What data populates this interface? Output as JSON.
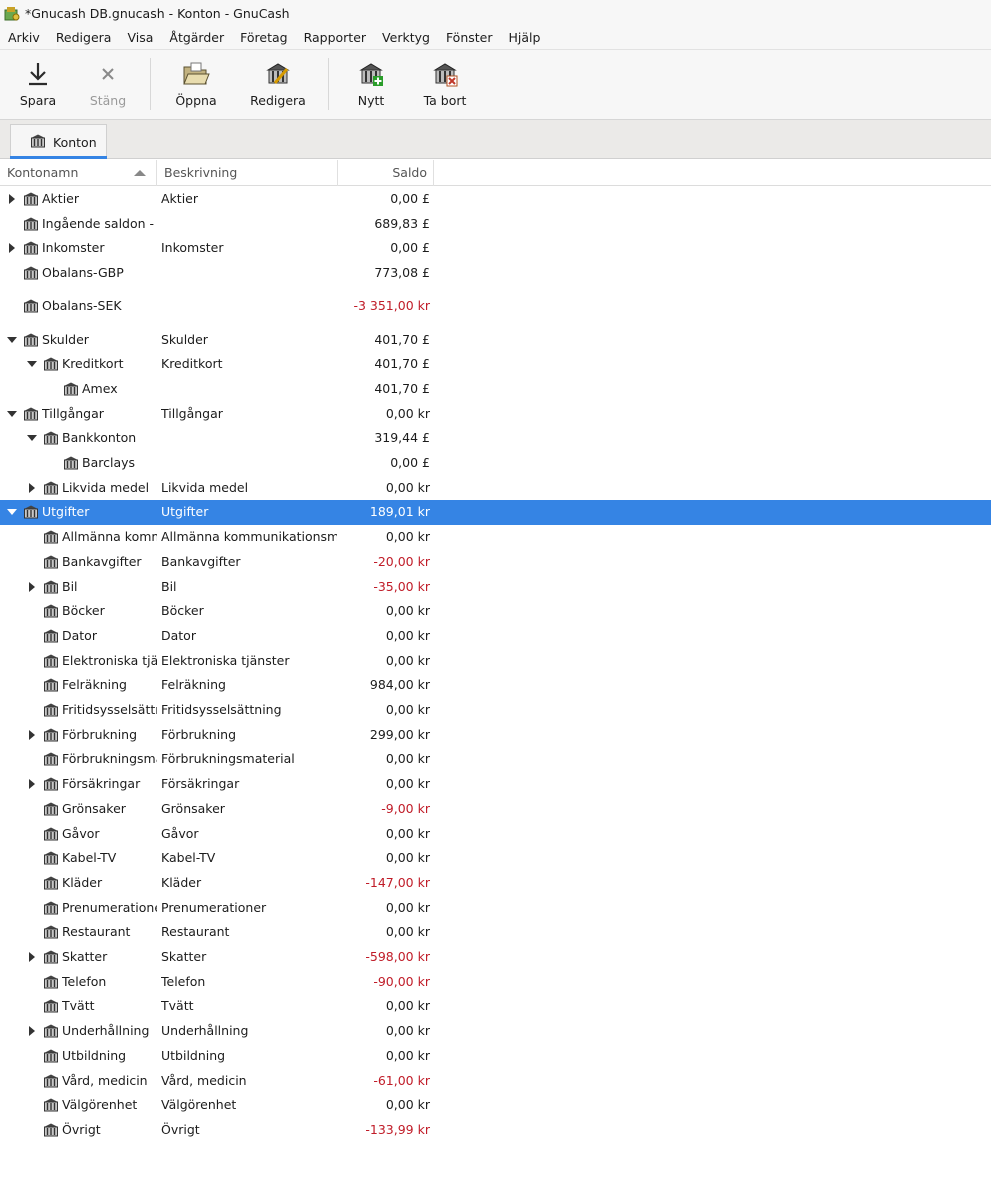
{
  "window": {
    "title": "*Gnucash DB.gnucash - Konton - GnuCash"
  },
  "menu": [
    "Arkiv",
    "Redigera",
    "Visa",
    "Åtgärder",
    "Företag",
    "Rapporter",
    "Verktyg",
    "Fönster",
    "Hjälp"
  ],
  "toolbar": {
    "save": "Spara",
    "close": "Stäng",
    "open": "Öppna",
    "edit": "Redigera",
    "new": "Nytt",
    "delete": "Ta bort"
  },
  "tab": {
    "label": "Konton"
  },
  "columns": {
    "name": "Kontonamn",
    "description": "Beskrivning",
    "balance": "Saldo"
  },
  "accounts": [
    {
      "name": "Aktier",
      "desc": "Aktier",
      "saldo": "0,00 £",
      "level": 0,
      "expander": "collapsed",
      "negative": false
    },
    {
      "name": "Ingående saldon - G",
      "desc": "",
      "saldo": "689,83 £",
      "level": 0,
      "expander": "none",
      "negative": false
    },
    {
      "name": "Inkomster",
      "desc": "Inkomster",
      "saldo": "0,00 £",
      "level": 0,
      "expander": "collapsed",
      "negative": false
    },
    {
      "name": "Obalans-GBP",
      "desc": "",
      "saldo": "773,08 £",
      "level": 0,
      "expander": "none",
      "negative": false
    },
    {
      "name": "Obalans-SEK",
      "desc": "",
      "saldo": "-3 351,00 kr",
      "level": 0,
      "expander": "none",
      "negative": true
    },
    {
      "name": "Skulder",
      "desc": "Skulder",
      "saldo": "401,70 £",
      "level": 0,
      "expander": "expanded",
      "negative": false
    },
    {
      "name": "Kreditkort",
      "desc": "Kreditkort",
      "saldo": "401,70 £",
      "level": 1,
      "expander": "expanded",
      "negative": false
    },
    {
      "name": "Amex",
      "desc": "",
      "saldo": "401,70 £",
      "level": 2,
      "expander": "none",
      "negative": false
    },
    {
      "name": "Tillgångar",
      "desc": "Tillgångar",
      "saldo": "0,00 kr",
      "level": 0,
      "expander": "expanded",
      "negative": false
    },
    {
      "name": "Bankkonton",
      "desc": "",
      "saldo": "319,44 £",
      "level": 1,
      "expander": "expanded",
      "negative": false
    },
    {
      "name": "Barclays",
      "desc": "",
      "saldo": "0,00 £",
      "level": 2,
      "expander": "none",
      "negative": false
    },
    {
      "name": "Likvida medel",
      "desc": "Likvida medel",
      "saldo": "0,00 kr",
      "level": 1,
      "expander": "collapsed",
      "negative": false
    },
    {
      "name": "Utgifter",
      "desc": "Utgifter",
      "saldo": "189,01 kr",
      "level": 0,
      "expander": "expanded",
      "negative": false,
      "selected": true
    },
    {
      "name": "Allmänna komm",
      "desc": "Allmänna kommunikationsmed",
      "saldo": "0,00 kr",
      "level": 1,
      "expander": "none",
      "negative": false
    },
    {
      "name": "Bankavgifter",
      "desc": "Bankavgifter",
      "saldo": "-20,00 kr",
      "level": 1,
      "expander": "none",
      "negative": true
    },
    {
      "name": "Bil",
      "desc": "Bil",
      "saldo": "-35,00 kr",
      "level": 1,
      "expander": "collapsed",
      "negative": true
    },
    {
      "name": "Böcker",
      "desc": "Böcker",
      "saldo": "0,00 kr",
      "level": 1,
      "expander": "none",
      "negative": false
    },
    {
      "name": "Dator",
      "desc": "Dator",
      "saldo": "0,00 kr",
      "level": 1,
      "expander": "none",
      "negative": false
    },
    {
      "name": "Elektroniska tjän",
      "desc": "Elektroniska tjänster",
      "saldo": "0,00 kr",
      "level": 1,
      "expander": "none",
      "negative": false
    },
    {
      "name": "Felräkning",
      "desc": "Felräkning",
      "saldo": "984,00 kr",
      "level": 1,
      "expander": "none",
      "negative": false
    },
    {
      "name": "Fritidsysselsättni",
      "desc": "Fritidsysselsättning",
      "saldo": "0,00 kr",
      "level": 1,
      "expander": "none",
      "negative": false
    },
    {
      "name": "Förbrukning",
      "desc": "Förbrukning",
      "saldo": "299,00 kr",
      "level": 1,
      "expander": "collapsed",
      "negative": false
    },
    {
      "name": "Förbrukningsma",
      "desc": "Förbrukningsmaterial",
      "saldo": "0,00 kr",
      "level": 1,
      "expander": "none",
      "negative": false
    },
    {
      "name": "Försäkringar",
      "desc": "Försäkringar",
      "saldo": "0,00 kr",
      "level": 1,
      "expander": "collapsed",
      "negative": false
    },
    {
      "name": "Grönsaker",
      "desc": "Grönsaker",
      "saldo": "-9,00 kr",
      "level": 1,
      "expander": "none",
      "negative": true
    },
    {
      "name": "Gåvor",
      "desc": "Gåvor",
      "saldo": "0,00 kr",
      "level": 1,
      "expander": "none",
      "negative": false
    },
    {
      "name": "Kabel-TV",
      "desc": "Kabel-TV",
      "saldo": "0,00 kr",
      "level": 1,
      "expander": "none",
      "negative": false
    },
    {
      "name": "Kläder",
      "desc": "Kläder",
      "saldo": "-147,00 kr",
      "level": 1,
      "expander": "none",
      "negative": true
    },
    {
      "name": "Prenumerationer",
      "desc": "Prenumerationer",
      "saldo": "0,00 kr",
      "level": 1,
      "expander": "none",
      "negative": false
    },
    {
      "name": "Restaurant",
      "desc": "Restaurant",
      "saldo": "0,00 kr",
      "level": 1,
      "expander": "none",
      "negative": false
    },
    {
      "name": "Skatter",
      "desc": "Skatter",
      "saldo": "-598,00 kr",
      "level": 1,
      "expander": "collapsed",
      "negative": true
    },
    {
      "name": "Telefon",
      "desc": "Telefon",
      "saldo": "-90,00 kr",
      "level": 1,
      "expander": "none",
      "negative": true
    },
    {
      "name": "Tvätt",
      "desc": "Tvätt",
      "saldo": "0,00 kr",
      "level": 1,
      "expander": "none",
      "negative": false
    },
    {
      "name": "Underhållning",
      "desc": "Underhållning",
      "saldo": "0,00 kr",
      "level": 1,
      "expander": "collapsed",
      "negative": false
    },
    {
      "name": "Utbildning",
      "desc": "Utbildning",
      "saldo": "0,00 kr",
      "level": 1,
      "expander": "none",
      "negative": false
    },
    {
      "name": "Vård, medicin",
      "desc": "Vård, medicin",
      "saldo": "-61,00 kr",
      "level": 1,
      "expander": "none",
      "negative": true
    },
    {
      "name": "Välgörenhet",
      "desc": "Välgörenhet",
      "saldo": "0,00 kr",
      "level": 1,
      "expander": "none",
      "negative": false
    },
    {
      "name": "Övrigt",
      "desc": "Övrigt",
      "saldo": "-133,99 kr",
      "level": 1,
      "expander": "none",
      "negative": true
    }
  ],
  "icons": {
    "app": "gnucash-app-icon",
    "save": "download-arrow-icon",
    "close": "close-x-icon",
    "open": "folder-open-icon",
    "edit": "account-edit-icon",
    "new": "account-new-icon",
    "delete": "account-delete-icon",
    "account": "bank-account-icon"
  },
  "colors": {
    "selection": "#3584e4",
    "negative": "#c01c28"
  }
}
